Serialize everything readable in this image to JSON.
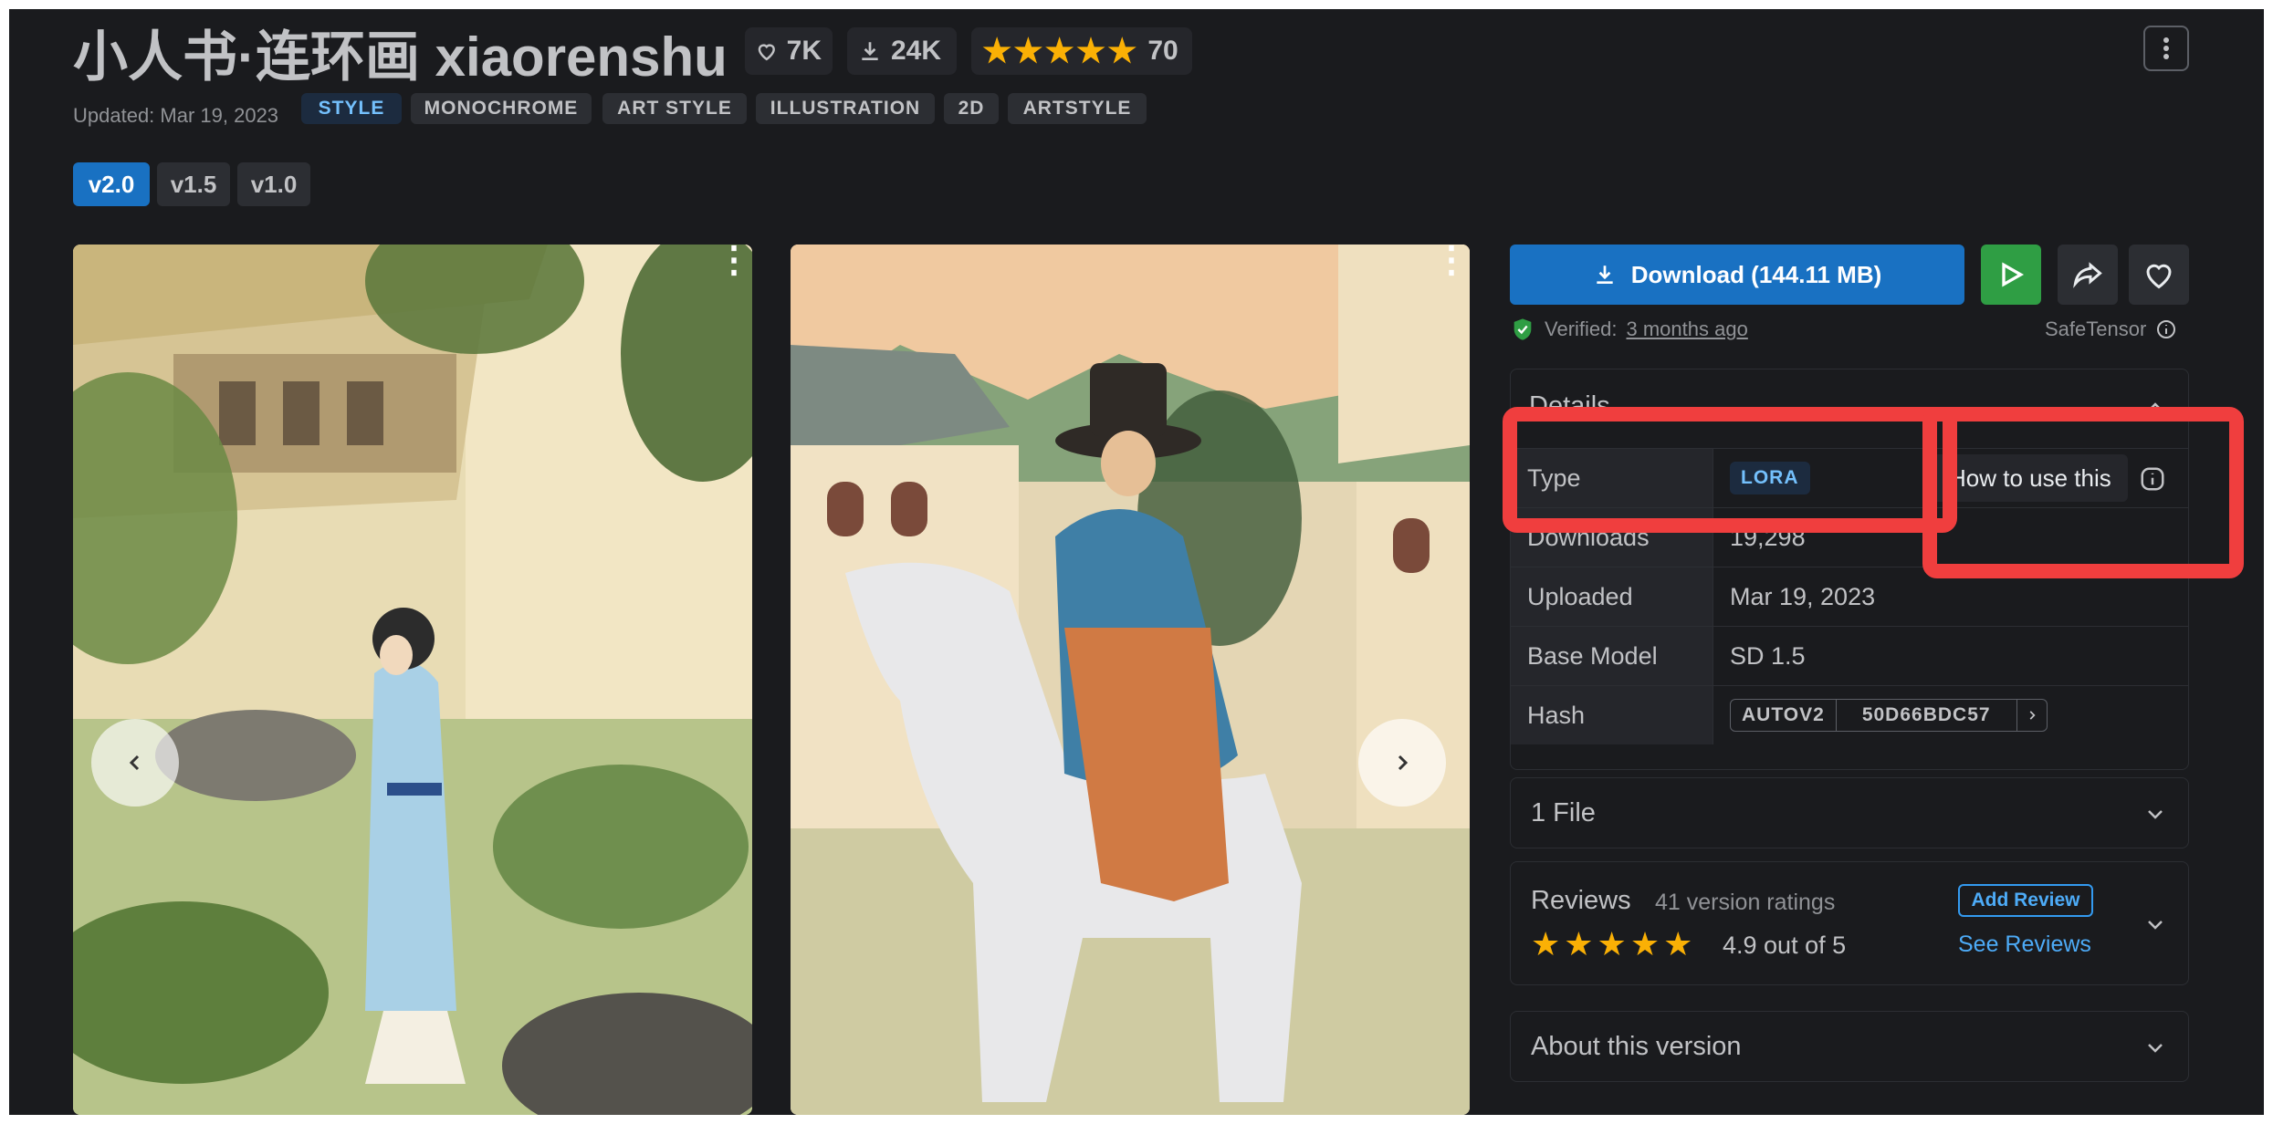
{
  "model": {
    "title": "小人书·连环画 xiaorenshu",
    "likes": "7K",
    "downloads": "24K",
    "rating_count": "70",
    "updated": "Updated: Mar 19, 2023",
    "tags": [
      "STYLE",
      "MONOCHROME",
      "ART STYLE",
      "ILLUSTRATION",
      "2D",
      "ARTSTYLE"
    ]
  },
  "versions": [
    "v2.0",
    "v1.5",
    "v1.0"
  ],
  "actions": {
    "download_label": "Download (144.11 MB)",
    "verified_prefix": "Verified:",
    "verified_time": "3 months ago",
    "safetensor": "SafeTensor"
  },
  "details": {
    "title": "Details",
    "rows": [
      {
        "key": "Type",
        "value": "LORA"
      },
      {
        "key": "Downloads",
        "value": "19,298"
      },
      {
        "key": "Uploaded",
        "value": "Mar 19, 2023"
      },
      {
        "key": "Base Model",
        "value": "SD 1.5"
      },
      {
        "key": "Hash",
        "value": ""
      }
    ],
    "how_to_use": "How to use this",
    "hash_type": "AUTOV2",
    "hash_value": "50D66BDC57"
  },
  "files": {
    "label": "1 File"
  },
  "reviews": {
    "title": "Reviews",
    "count": "41 version ratings",
    "score": "4.9 out of 5",
    "add_review": "Add Review",
    "see_reviews": "See Reviews"
  },
  "about": {
    "label": "About this version"
  },
  "colors": {
    "accent": "#1971c2",
    "success": "#2f9e44",
    "star": "#fab005",
    "highlight": "#f03e3e"
  }
}
